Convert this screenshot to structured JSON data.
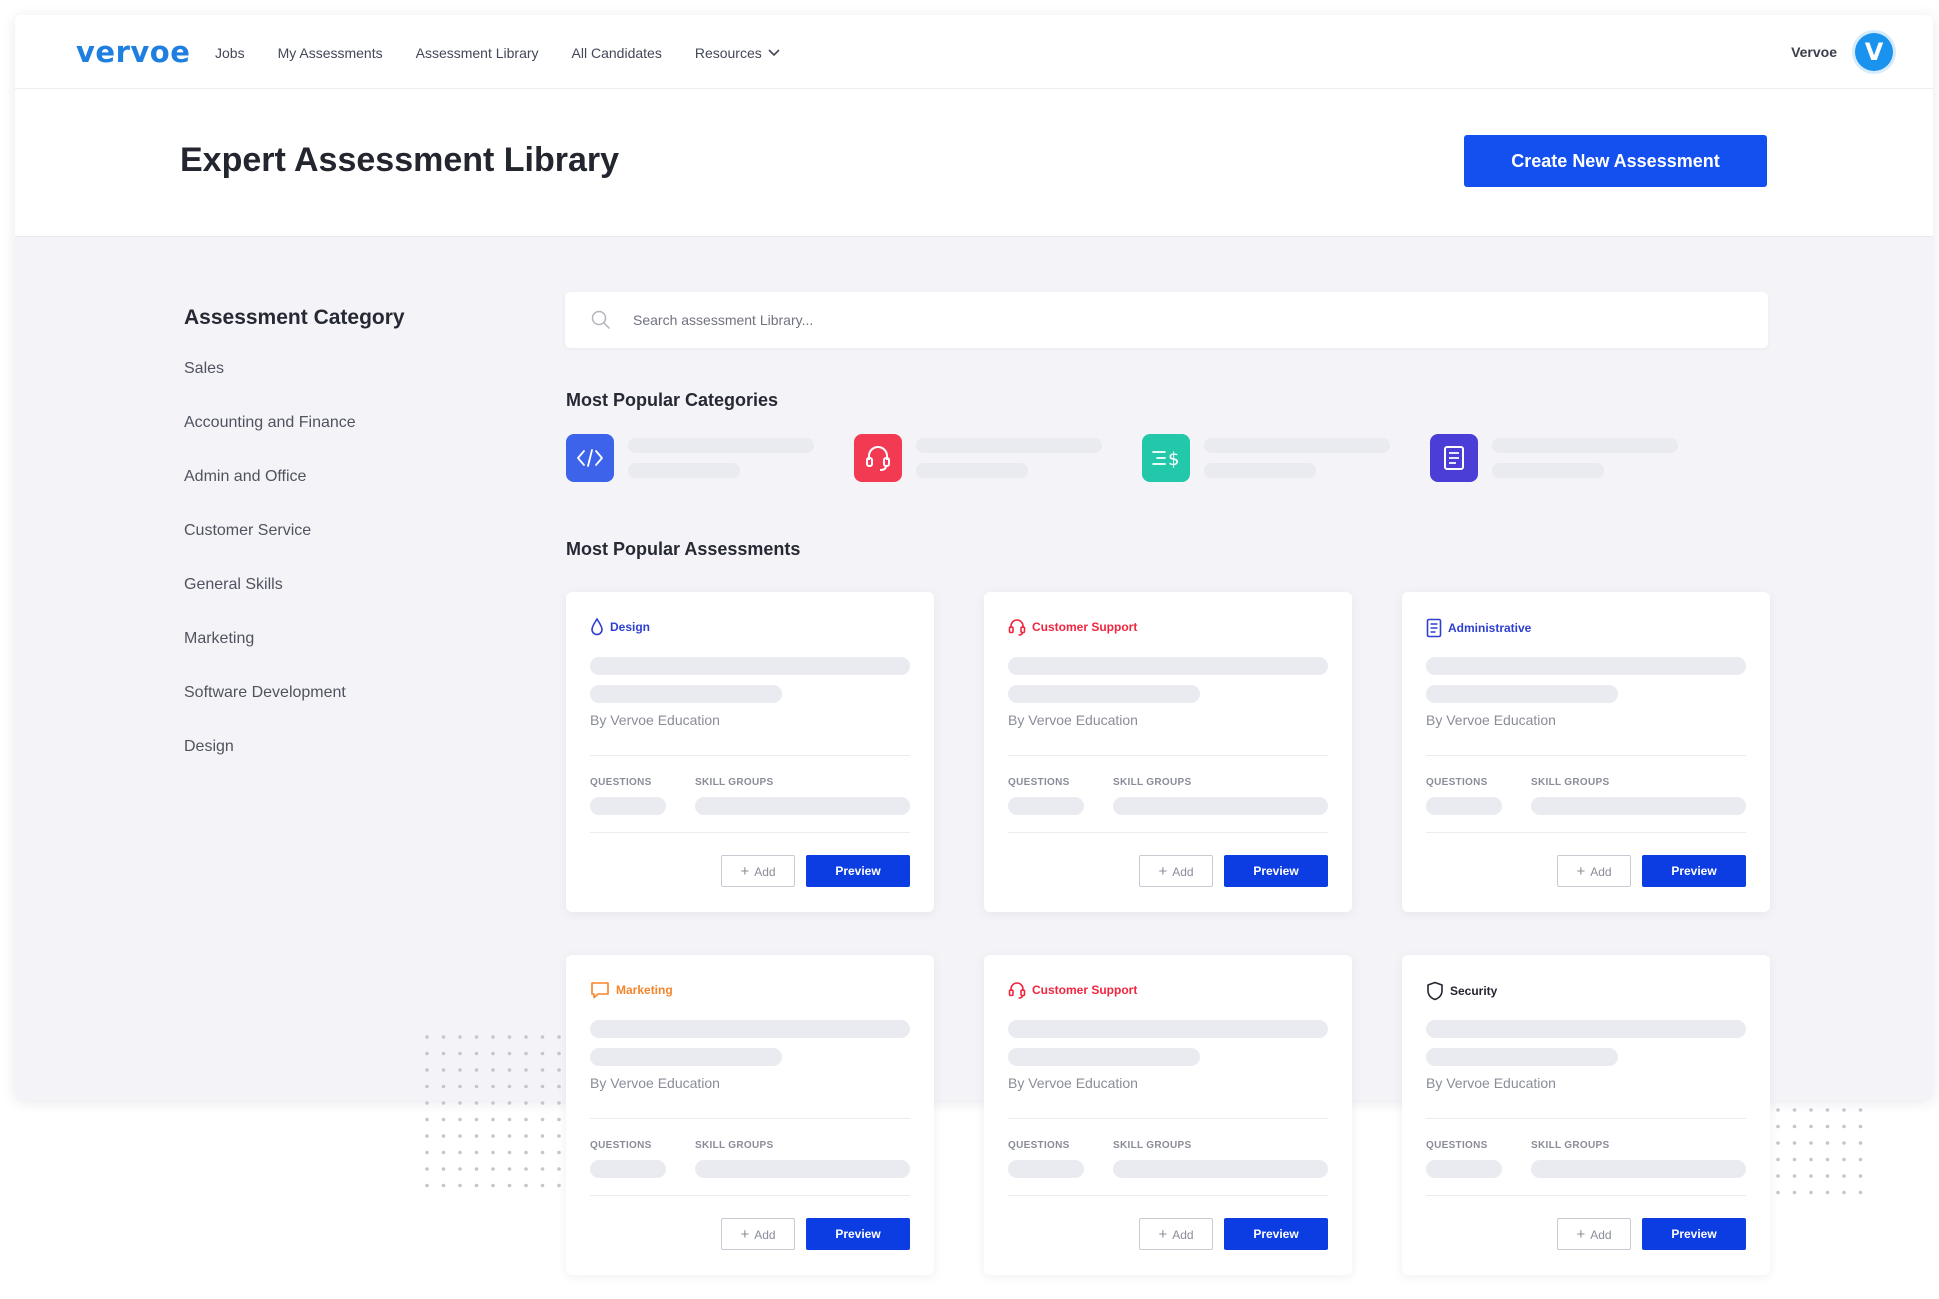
{
  "nav": {
    "logo": "vervoe",
    "links": [
      "Jobs",
      "My Assessments",
      "Assessment Library",
      "All Candidates",
      "Resources"
    ],
    "user_name": "Vervoe",
    "avatar_letter": "V"
  },
  "header": {
    "title": "Expert Assessment Library",
    "create_button": "Create New Assessment"
  },
  "sidebar": {
    "title": "Assessment Category",
    "items": [
      "Sales",
      "Accounting and Finance",
      "Admin and Office",
      "Customer Service",
      "General Skills",
      "Marketing",
      "Software Development",
      "Design"
    ]
  },
  "search": {
    "placeholder": "Search assessment Library..."
  },
  "popular_categories": {
    "title": "Most Popular Categories",
    "items": [
      {
        "icon": "code-icon",
        "color": "#3d63ea"
      },
      {
        "icon": "headset-icon",
        "color": "#f23a52"
      },
      {
        "icon": "list-dollar-icon",
        "color": "#23c7a9"
      },
      {
        "icon": "document-icon",
        "color": "#4a3ed6"
      }
    ]
  },
  "popular_assessments": {
    "title": "Most Popular Assessments",
    "cards": [
      {
        "tag": "Design",
        "tag_icon": "drop-icon",
        "tag_color": "#2d3fd0",
        "author": "By Vervoe Education",
        "questions_label": "QUESTIONS",
        "skill_groups_label": "SKILL GROUPS",
        "add_label": "Add",
        "preview_label": "Preview"
      },
      {
        "tag": "Customer Support",
        "tag_icon": "headset-icon",
        "tag_color": "#f0263f",
        "author": "By Vervoe Education",
        "questions_label": "QUESTIONS",
        "skill_groups_label": "SKILL GROUPS",
        "add_label": "Add",
        "preview_label": "Preview"
      },
      {
        "tag": "Administrative",
        "tag_icon": "document-icon",
        "tag_color": "#2d3fd0",
        "author": "By Vervoe Education",
        "questions_label": "QUESTIONS",
        "skill_groups_label": "SKILL GROUPS",
        "add_label": "Add",
        "preview_label": "Preview"
      },
      {
        "tag": "Marketing",
        "tag_icon": "chat-icon",
        "tag_color": "#f5852a",
        "author": "By Vervoe Education",
        "questions_label": "QUESTIONS",
        "skill_groups_label": "SKILL GROUPS",
        "add_label": "Add",
        "preview_label": "Preview"
      },
      {
        "tag": "Customer Support",
        "tag_icon": "headset-icon",
        "tag_color": "#f0263f",
        "author": "By Vervoe Education",
        "questions_label": "QUESTIONS",
        "skill_groups_label": "SKILL GROUPS",
        "add_label": "Add",
        "preview_label": "Preview"
      },
      {
        "tag": "Security",
        "tag_icon": "shield-icon",
        "tag_color": "#23252f",
        "author": "By Vervoe Education",
        "questions_label": "QUESTIONS",
        "skill_groups_label": "SKILL GROUPS",
        "add_label": "Add",
        "preview_label": "Preview"
      }
    ]
  }
}
